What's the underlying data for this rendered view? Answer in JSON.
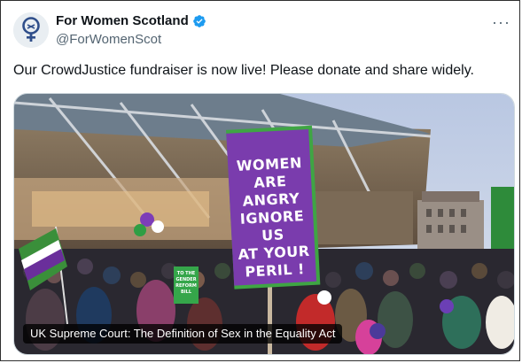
{
  "author": {
    "name": "For Women Scotland",
    "handle": "@ForWomenScot",
    "verified": true
  },
  "tweet": {
    "text": "Our CrowdJustice fundraiser is now live! Please donate and share widely."
  },
  "media": {
    "caption": "UK Supreme Court: The Definition of Sex in the Equality Act",
    "placard_lines": [
      "WOMEN",
      "ARE ANGRY",
      "IGNORE US",
      "AT YOUR",
      "PERIL !"
    ],
    "small_placard_lines": [
      "TO THE",
      "GENDER",
      "REFORM",
      "BILL"
    ]
  },
  "colors": {
    "verified_badge": "#1d9bf0",
    "placard_purple": "#7b3fb1",
    "placard_green": "#3d9b3d",
    "sky": "#c9d6ea"
  },
  "icons": {
    "verified": "verified-badge-icon",
    "more": "more-options-icon"
  }
}
